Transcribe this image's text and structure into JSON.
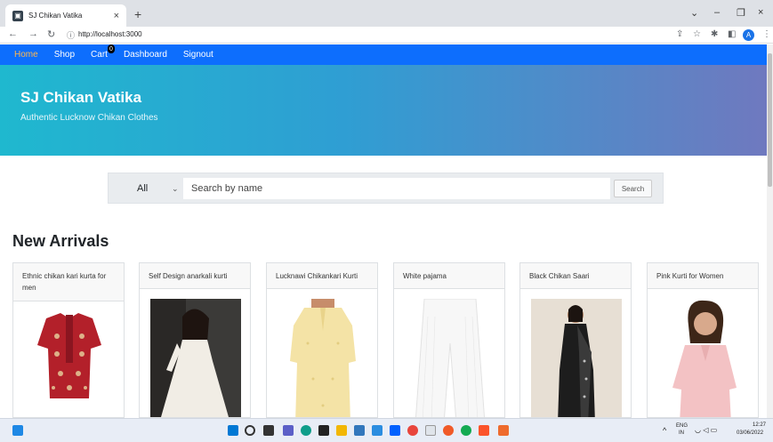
{
  "browser": {
    "tab_title": "SJ Chikan Vatika",
    "url": "http://localhost:3000",
    "profile_initial": "A"
  },
  "nav": {
    "links": [
      "Home",
      "Shop",
      "Cart",
      "Dashboard",
      "Signout"
    ],
    "cart_count": "0"
  },
  "hero": {
    "title": "SJ Chikan Vatika",
    "subtitle": "Authentic Lucknow Chikan Clothes"
  },
  "search": {
    "category": "All",
    "placeholder": "Search by name",
    "button": "Search"
  },
  "section_title": "New Arrivals",
  "products": [
    {
      "name": "Ethnic chikan kari kurta for men"
    },
    {
      "name": "Self Design anarkali kurti"
    },
    {
      "name": "Lucknawi Chikankari Kurti"
    },
    {
      "name": "White pajama"
    },
    {
      "name": "Black Chikan Saari"
    },
    {
      "name": "Pink Kurti for Women"
    }
  ],
  "taskbar": {
    "lang": "ENG",
    "region": "IN",
    "time": "12:27",
    "date": "03/06/2022"
  },
  "colors": {
    "navbar": "#0d6efd",
    "hero_start": "#1fb8cf",
    "hero_end": "#6f79bf"
  }
}
